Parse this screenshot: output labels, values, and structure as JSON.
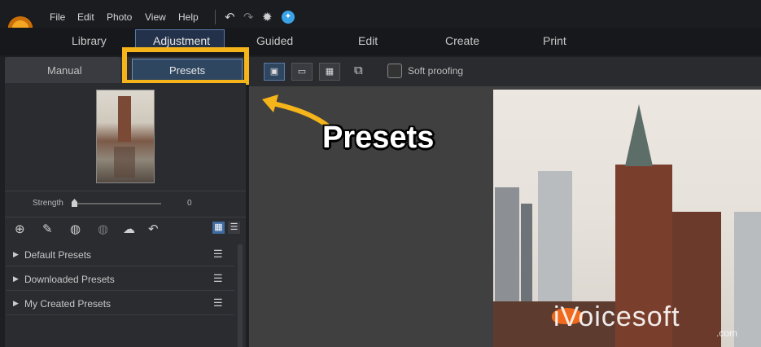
{
  "menu": {
    "items": [
      {
        "label": "File"
      },
      {
        "label": "Edit"
      },
      {
        "label": "Photo"
      },
      {
        "label": "View"
      },
      {
        "label": "Help"
      }
    ],
    "toolbar_icons": [
      "undo-icon",
      "redo-icon",
      "settings-icon",
      "notification-icon"
    ]
  },
  "modules": {
    "tabs": [
      {
        "label": "Library"
      },
      {
        "label": "Adjustment",
        "active": true
      },
      {
        "label": "Guided"
      },
      {
        "label": "Edit"
      },
      {
        "label": "Create"
      },
      {
        "label": "Print"
      }
    ]
  },
  "left_panel": {
    "subtabs": {
      "manual": "Manual",
      "presets": "Presets"
    },
    "strength": {
      "label": "Strength",
      "value": "0"
    },
    "icon_row": [
      "add-preset-icon",
      "edit-preset-icon",
      "import-preset-icon",
      "export-preset-icon",
      "cloud-icon",
      "undo-icon",
      "grid-view-icon",
      "list-view-icon"
    ],
    "groups": [
      {
        "label": "Default Presets"
      },
      {
        "label": "Downloaded Presets"
      },
      {
        "label": "My Created Presets"
      }
    ]
  },
  "toolbar": {
    "view_buttons": [
      "single-view-icon",
      "filmstrip-view-icon",
      "grid-view-icon"
    ],
    "soft_proofing_label": "Soft proofing"
  },
  "annotation": {
    "text": "Presets",
    "highlight_color": "#f4b41a"
  },
  "watermark": {
    "text": "iVoicesoft",
    "sub": ".com"
  },
  "colors": {
    "accent": "#3aa3e8",
    "highlight": "#f4b41a",
    "active_tab": "#2e4660"
  }
}
